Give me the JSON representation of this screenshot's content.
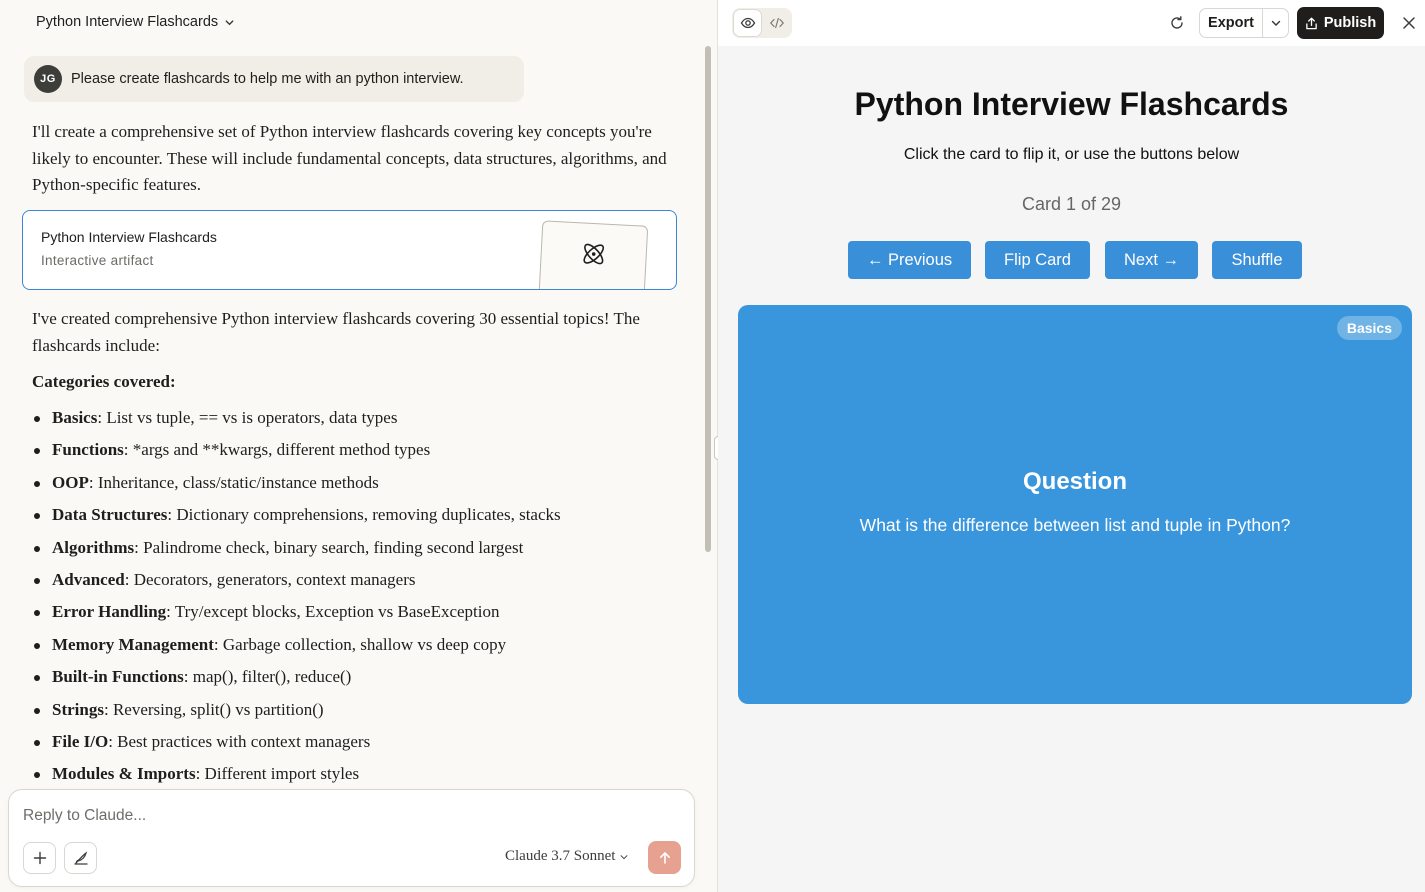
{
  "chat": {
    "title": "Python Interview Flashcards",
    "user": {
      "initials": "JG",
      "message": "Please create flashcards to help me with an python interview."
    },
    "reply_intro": "I'll create a comprehensive set of Python interview flashcards covering key concepts you're likely to encounter. These will include fundamental concepts, data structures, algorithms, and Python-specific features.",
    "artifact": {
      "title": "Python Interview Flashcards",
      "subtitle": "Interactive artifact",
      "icon": "atom-icon"
    },
    "reply_summary": "I've created comprehensive Python interview flashcards covering 30 essential topics! The flashcards include:",
    "categories_heading": "Categories covered:",
    "categories": [
      {
        "name": "Basics",
        "desc": ": List vs tuple, == vs is operators, data types"
      },
      {
        "name": "Functions",
        "desc": ": *args and **kwargs, different method types"
      },
      {
        "name": "OOP",
        "desc": ": Inheritance, class/static/instance methods"
      },
      {
        "name": "Data Structures",
        "desc": ": Dictionary comprehensions, removing duplicates, stacks"
      },
      {
        "name": "Algorithms",
        "desc": ": Palindrome check, binary search, finding second largest"
      },
      {
        "name": "Advanced",
        "desc": ": Decorators, generators, context managers"
      },
      {
        "name": "Error Handling",
        "desc": ": Try/except blocks, Exception vs BaseException"
      },
      {
        "name": "Memory Management",
        "desc": ": Garbage collection, shallow vs deep copy"
      },
      {
        "name": "Built-in Functions",
        "desc": ": map(), filter(), reduce()"
      },
      {
        "name": "Strings",
        "desc": ": Reversing, split() vs partition()"
      },
      {
        "name": "File I/O",
        "desc": ": Best practices with context managers"
      },
      {
        "name": "Modules & Imports",
        "desc": ": Different import styles"
      }
    ],
    "composer": {
      "placeholder": "Reply to Claude...",
      "model": "Claude 3.7 Sonnet"
    }
  },
  "artifact_panel": {
    "export_label": "Export",
    "publish_label": "Publish",
    "app": {
      "title": "Python Interview Flashcards",
      "instructions": "Click the card to flip it, or use the buttons below",
      "counter": "Card 1 of 29",
      "buttons": {
        "previous": "← Previous",
        "flip": "Flip Card",
        "next": "Next →",
        "shuffle": "Shuffle"
      },
      "card": {
        "category": "Basics",
        "side": "Question",
        "text": "What is the difference between list and tuple in Python?",
        "color": "#3a96dc"
      }
    }
  },
  "colors": {
    "accent_button": "#3a8fd9",
    "send_button": "#e6a190",
    "artifact_border": "#3b86d7"
  }
}
